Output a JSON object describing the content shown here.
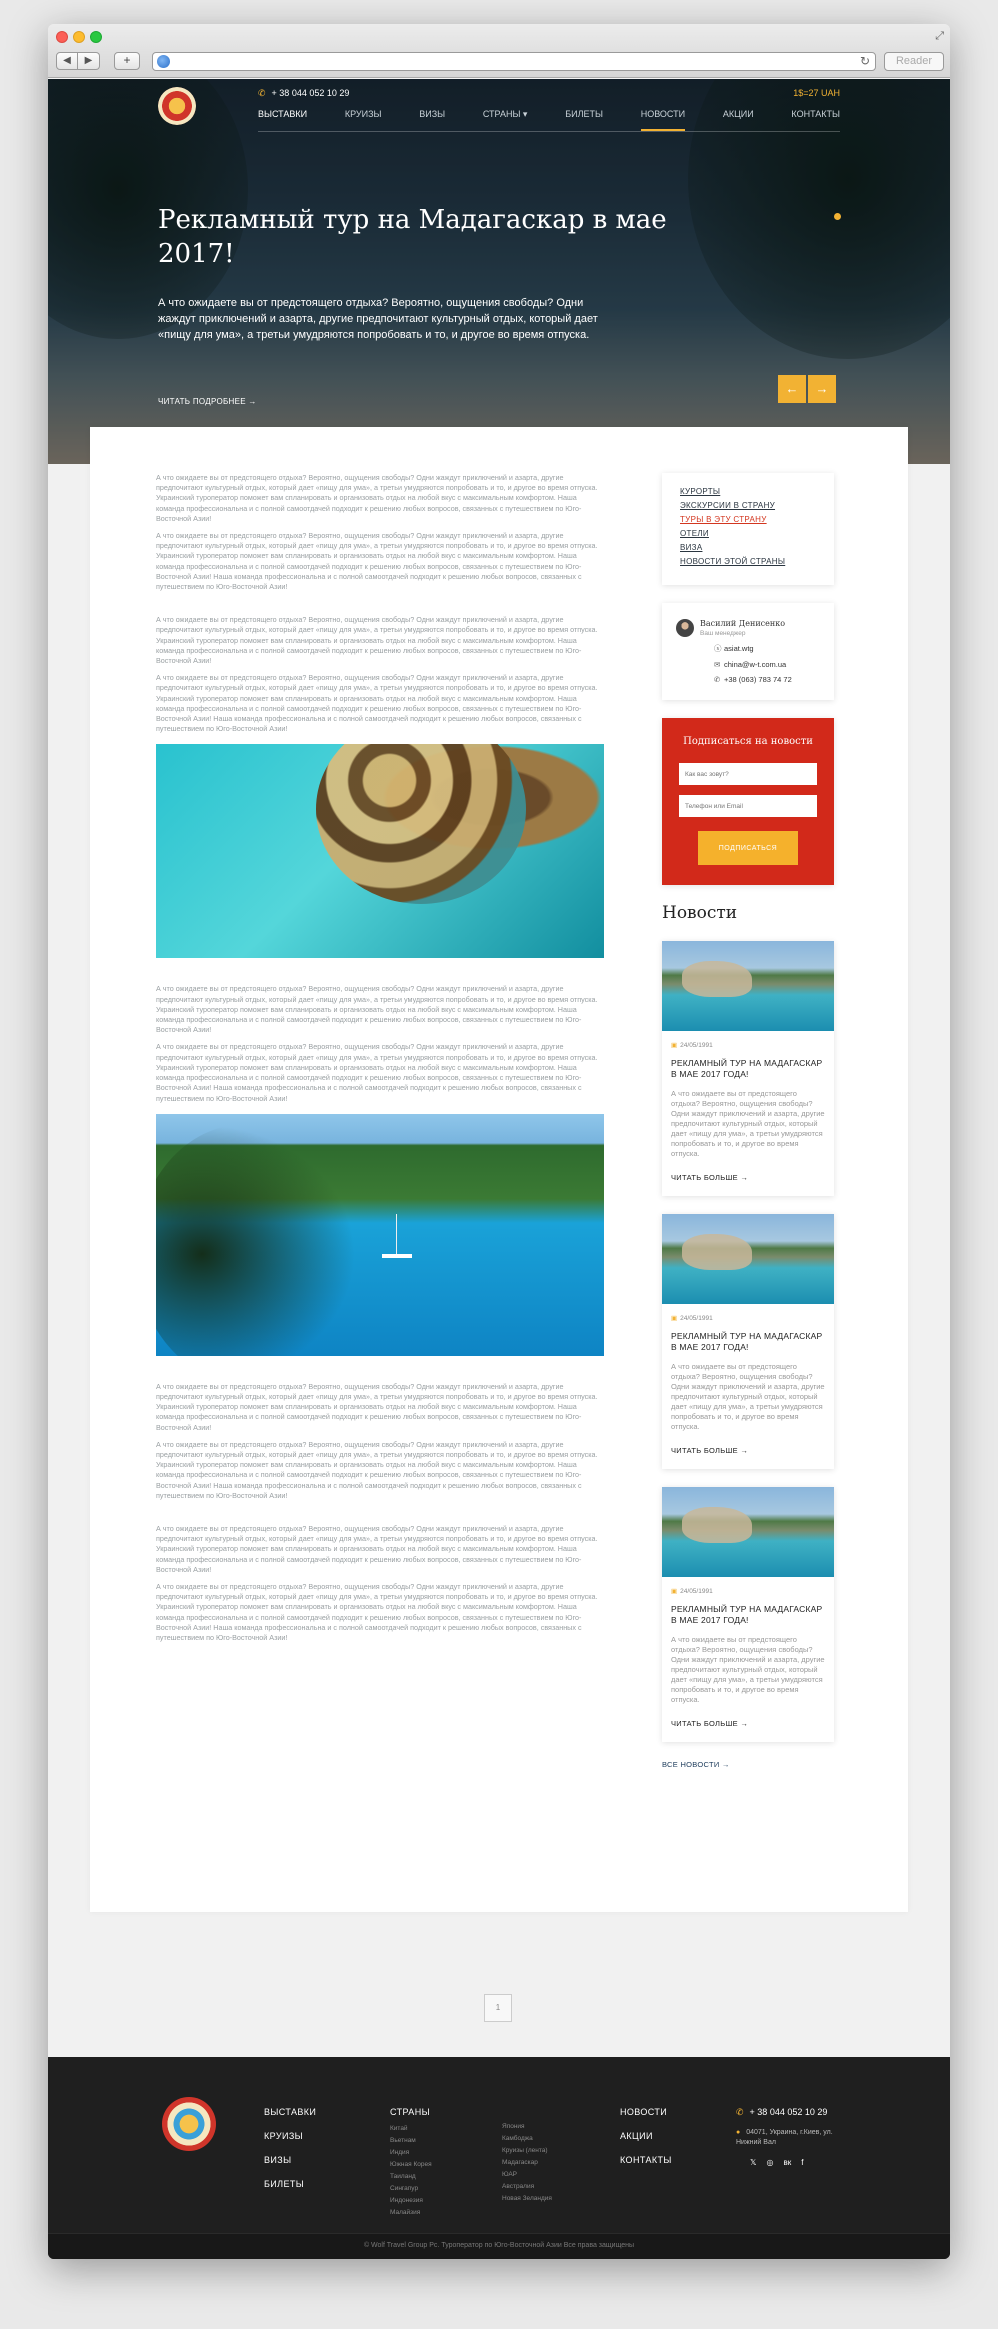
{
  "browser": {
    "back": "◀",
    "forward": "▶",
    "new_tab": "+",
    "reload": "↻",
    "reader": "Reader"
  },
  "header": {
    "phone": "+ 38 044 052 10 29",
    "rate": "1$=27 UAH",
    "nav": [
      {
        "label": "ВЫСТАВКИ"
      },
      {
        "label": "КРУИЗЫ"
      },
      {
        "label": "ВИЗЫ"
      },
      {
        "label": "СТРАНЫ ▾"
      },
      {
        "label": "БИЛЕТЫ"
      },
      {
        "label": "НОВОСТИ"
      },
      {
        "label": "АКЦИИ"
      },
      {
        "label": "КОНТАКТЫ"
      }
    ]
  },
  "hero": {
    "title": "Рекламный тур на Мадагаскар в мае 2017!",
    "text": "А что ожидаете вы от предстоящего отдыха? Вероятно, ощущения свободы? Одни жаждут приключений и азарта, другие предпочитают культурный отдых, который дает «пищу для ума», а третьи умудряются попробовать и то, и другое во время отпуска.",
    "more": "ЧИТАТЬ ПОДРОБНЕЕ →",
    "prev": "←",
    "next": "→"
  },
  "article": {
    "p_short": "А что ожидаете вы от предстоящего отдыха? Вероятно, ощущения свободы? Одни жаждут приключений и азарта, другие предпочитают культурный отдых, который дает «пищу для ума», а третьи умудряются попробовать и то, и другое во время отпуска. Украинский туроператор поможет вам спланировать и организовать отдых на любой вкус с максимальным комфортом. Наша команда профессиональна и с полной самоотдачей подходит к решению любых вопросов, связанных с путешествием по Юго-Восточной Азии!",
    "p_long": "А что ожидаете вы от предстоящего отдыха? Вероятно, ощущения свободы? Одни жаждут приключений и азарта, другие предпочитают культурный отдых, который дает «пищу для ума», а третьи умудряются попробовать и то, и другое во время отпуска. Украинский туроператор поможет вам спланировать и организовать отдых на любой вкус с максимальным комфортом. Наша команда профессиональна и с полной самоотдачей подходит к решению любых вопросов, связанных с путешествием по Юго-Восточной Азии! Наша команда профессиональна и с полной самоотдачей подходит к решению любых вопросов, связанных с путешествием по Юго-Восточной Азии!"
  },
  "sidebar": {
    "links": [
      {
        "label": "КУРОРТЫ"
      },
      {
        "label": "ЭКСКУРСИИ В СТРАНУ"
      },
      {
        "label": "ТУРЫ В ЭТУ СТРАНУ"
      },
      {
        "label": "ОТЕЛИ"
      },
      {
        "label": "ВИЗА"
      },
      {
        "label": "НОВОСТИ ЭТОЙ СТРАНЫ"
      }
    ],
    "manager": {
      "name": "Василий Денисенко",
      "role": "Ваш менеджер",
      "skype": "asiat.wtg",
      "email": "china@w-t.com.ua",
      "phone": "+38 (063) 783 74 72"
    },
    "subscribe": {
      "title": "Подписаться на новости",
      "name_placeholder": "Как вас зовут?",
      "contact_placeholder": "Телефон или Email",
      "button": "ПОДПИСАТЬСЯ"
    },
    "news_heading": "Новости",
    "news": [
      {
        "date": "24/05/1991",
        "title": "РЕКЛАМНЫЙ ТУР НА МАДАГАСКАР В МАЕ 2017 ГОДА!",
        "text": "А что ожидаете вы от предстоящего отдыха? Вероятно, ощущения свободы? Одни жаждут приключений и азарта, другие предпочитают культурный отдых, который дает «пищу для ума», а третьи умудряются попробовать и то, и другое во время отпуска.",
        "more": "ЧИТАТЬ БОЛЬШЕ →"
      },
      {
        "date": "24/05/1991",
        "title": "РЕКЛАМНЫЙ ТУР НА МАДАГАСКАР В МАЕ 2017 ГОДА!",
        "text": "А что ожидаете вы от предстоящего отдыха? Вероятно, ощущения свободы? Одни жаждут приключений и азарта, другие предпочитают культурный отдых, который дает «пищу для ума», а третьи умудряются попробовать и то, и другое во время отпуска.",
        "more": "ЧИТАТЬ БОЛЬШЕ →"
      },
      {
        "date": "24/05/1991",
        "title": "РЕКЛАМНЫЙ ТУР НА МАДАГАСКАР В МАЕ 2017 ГОДА!",
        "text": "А что ожидаете вы от предстоящего отдыха? Вероятно, ощущения свободы? Одни жаждут приключений и азарта, другие предпочитают культурный отдых, который дает «пищу для ума», а третьи умудряются попробовать и то, и другое во время отпуска.",
        "more": "ЧИТАТЬ БОЛЬШЕ →"
      }
    ],
    "all_news": "ВСЕ НОВОСТИ →"
  },
  "pager": {
    "page": "1"
  },
  "footer": {
    "main_links": [
      {
        "label": "ВЫСТАВКИ"
      },
      {
        "label": "КРУИЗЫ"
      },
      {
        "label": "ВИЗЫ"
      },
      {
        "label": "БИЛЕТЫ"
      }
    ],
    "countries_heading": "СТРАНЫ",
    "countries_1": [
      "Китай",
      "Вьетнам",
      "Индия",
      "Южная Корея",
      "Таиланд",
      "Сингапур",
      "Индонезия",
      "Малайзия"
    ],
    "countries_2": [
      "Япония",
      "Камбоджа",
      "Круизы (лента)",
      "Мадагаскар",
      "ЮАР",
      "Австралия",
      "Новая Зеландия"
    ],
    "side_links": [
      {
        "label": "НОВОСТИ"
      },
      {
        "label": "АКЦИИ"
      },
      {
        "label": "КОНТАКТЫ"
      }
    ],
    "phone": "+ 38 044 052 10 29",
    "address": "04071, Украина, г.Киев, ул. Нижний Вал",
    "social": [
      "𝕏",
      "◎",
      "вк",
      "f"
    ],
    "copyright": "© Wolf Travel Group Pc. Туроператор по Юго-Восточной Азии Все права защищены"
  },
  "colors": {
    "accent": "#f2b233",
    "red": "#d2291a",
    "footer": "#1f1f1f"
  }
}
